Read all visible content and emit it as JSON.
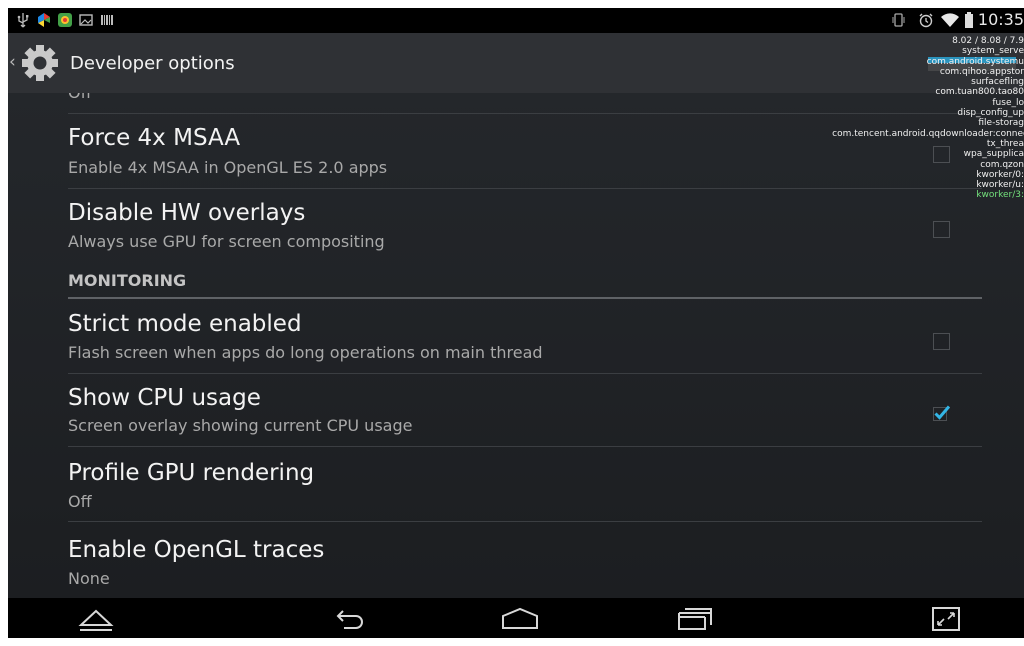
{
  "status_bar": {
    "clock": "10:35",
    "left_icons": [
      "usb-icon",
      "app-icon",
      "app-icon",
      "image-icon",
      "barcode-icon"
    ],
    "right_icons": [
      "vibrate-icon",
      "alarm-icon",
      "wifi-icon",
      "battery-icon"
    ]
  },
  "action_bar": {
    "title": "Developer options",
    "up_caret": "‹"
  },
  "list": {
    "partial_row_sub": "Off",
    "items": [
      {
        "title": "Force 4x MSAA",
        "subtitle": "Enable 4x MSAA in OpenGL ES 2.0 apps",
        "checkbox": false
      },
      {
        "title": "Disable HW overlays",
        "subtitle": "Always use GPU for screen compositing",
        "checkbox": false
      },
      {
        "section": "MONITORING"
      },
      {
        "title": "Strict mode enabled",
        "subtitle": "Flash screen when apps do long operations on main thread",
        "checkbox": false
      },
      {
        "title": "Show CPU usage",
        "subtitle": "Screen overlay showing current CPU usage",
        "checkbox": true
      },
      {
        "title": "Profile GPU rendering",
        "subtitle": "Off"
      },
      {
        "title": "Enable OpenGL traces",
        "subtitle": "None"
      }
    ]
  },
  "cpu_overlay": {
    "load": "8.02 / 8.08 / 7.9",
    "processes": [
      "system_serve",
      "com.android.systemu",
      "com.qihoo.appstor",
      "surfacefling",
      "com.tuan800.tao80",
      "fuse_lo",
      "disp_config_up",
      "file-storag",
      "com.tencent.android.qqdownloader:connec",
      "tx_threa",
      "wpa_supplica",
      "com.qzon",
      "kworker/0:",
      "kworker/u:",
      "kworker/3:"
    ]
  },
  "nav_bar": {
    "buttons": [
      "home-up-icon",
      "back-icon",
      "home-icon",
      "recents-icon",
      "expand-icon"
    ]
  },
  "colors": {
    "accent": "#33b5e5",
    "background": "#1d2024",
    "action_bar": "#2f3135"
  }
}
